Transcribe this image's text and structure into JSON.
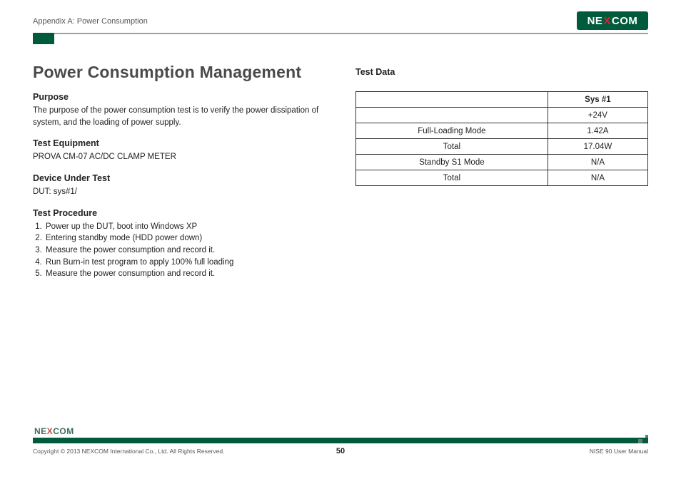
{
  "header": {
    "appendix_label": "Appendix A: Power Consumption",
    "logo_text_1": "NE",
    "logo_text_x": "X",
    "logo_text_2": "COM"
  },
  "main": {
    "title": "Power Consumption Management",
    "purpose": {
      "heading": "Purpose",
      "text": "The purpose of the power consumption test is to verify the power dissipation of system, and the loading of power supply."
    },
    "equipment": {
      "heading": "Test Equipment",
      "text": "PROVA CM-07 AC/DC CLAMP METER"
    },
    "dut": {
      "heading": "Device Under Test",
      "text": "DUT: sys#1/"
    },
    "procedure": {
      "heading": "Test Procedure",
      "steps": [
        "Power up the DUT, boot into Windows XP",
        "Entering standby mode (HDD power down)",
        "Measure the power consumption and record it.",
        "Run Burn-in test program to apply 100% full loading",
        "Measure the power consumption and record it."
      ]
    }
  },
  "testdata": {
    "heading": "Test Data",
    "col_header": "Sys #1",
    "rows": [
      {
        "label": "",
        "value": "+24V"
      },
      {
        "label": "Full-Loading Mode",
        "value": "1.42A"
      },
      {
        "label": "Total",
        "value": "17.04W"
      },
      {
        "label": "Standby S1 Mode",
        "value": "N/A"
      },
      {
        "label": "Total",
        "value": "N/A"
      }
    ]
  },
  "footer": {
    "logo_text_1": "NE",
    "logo_text_x": "X",
    "logo_text_2": "COM",
    "copyright": "Copyright © 2013 NEXCOM International Co., Ltd. All Rights Reserved.",
    "page_number": "50",
    "doc_name": "NISE 90 User Manual"
  }
}
